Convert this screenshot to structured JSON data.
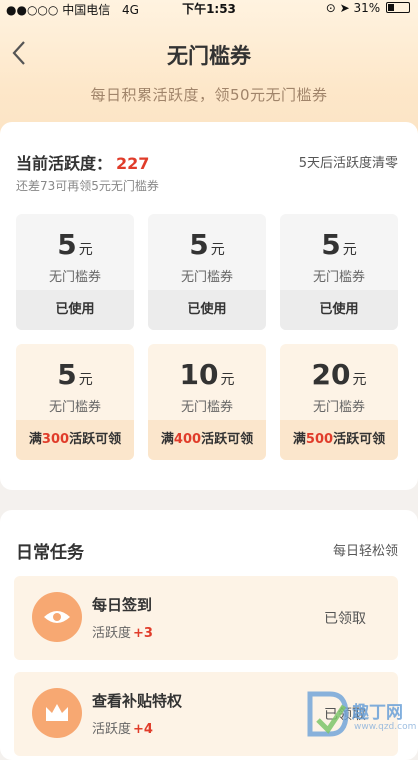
{
  "status_bar": {
    "carrier": "中国电信",
    "network": "4G",
    "time": "下午1:53",
    "battery": "31%",
    "battery_level": 0.31
  },
  "header": {
    "back_label": "<",
    "title": "无门槛券",
    "subtitle": "每日积累活跃度，领50元无门槛券"
  },
  "activity": {
    "label": "当前活跃度：",
    "value": "227",
    "reset_note": "5天后活跃度清零",
    "remaining_note": "还差73可再领5元无门槛券"
  },
  "coupons": [
    {
      "amount": "5",
      "unit": "元",
      "label": "无门槛券",
      "footer": "已使用",
      "state": "used"
    },
    {
      "amount": "5",
      "unit": "元",
      "label": "无门槛券",
      "footer": "已使用",
      "state": "used"
    },
    {
      "amount": "5",
      "unit": "元",
      "label": "无门槛券",
      "footer": "已使用",
      "state": "used"
    },
    {
      "amount": "5",
      "unit": "元",
      "label": "无门槛券",
      "footer_pre": "满",
      "footer_hl": "300",
      "footer_post": "活跃可领",
      "state": "locked"
    },
    {
      "amount": "10",
      "unit": "元",
      "label": "无门槛券",
      "footer_pre": "满",
      "footer_hl": "400",
      "footer_post": "活跃可领",
      "state": "locked"
    },
    {
      "amount": "20",
      "unit": "元",
      "label": "无门槛券",
      "footer_pre": "满",
      "footer_hl": "500",
      "footer_post": "活跃可领",
      "state": "locked"
    }
  ],
  "tasks": {
    "title": "日常任务",
    "note": "每日轻松领",
    "items": [
      {
        "name": "每日签到",
        "sub_label": "活跃度",
        "plus": "+3",
        "status": "已领取",
        "icon": "eye-icon"
      },
      {
        "name": "查看补贴特权",
        "sub_label": "活跃度",
        "plus": "+4",
        "status": "已领取",
        "icon": "crown-icon"
      }
    ]
  },
  "watermark": {
    "text": "趣丁网",
    "url": "www.qzd.com"
  },
  "colors": {
    "accent_red": "#e03c2a",
    "orange_icon": "#f7a872",
    "hero_bg": "#fde7c9"
  }
}
